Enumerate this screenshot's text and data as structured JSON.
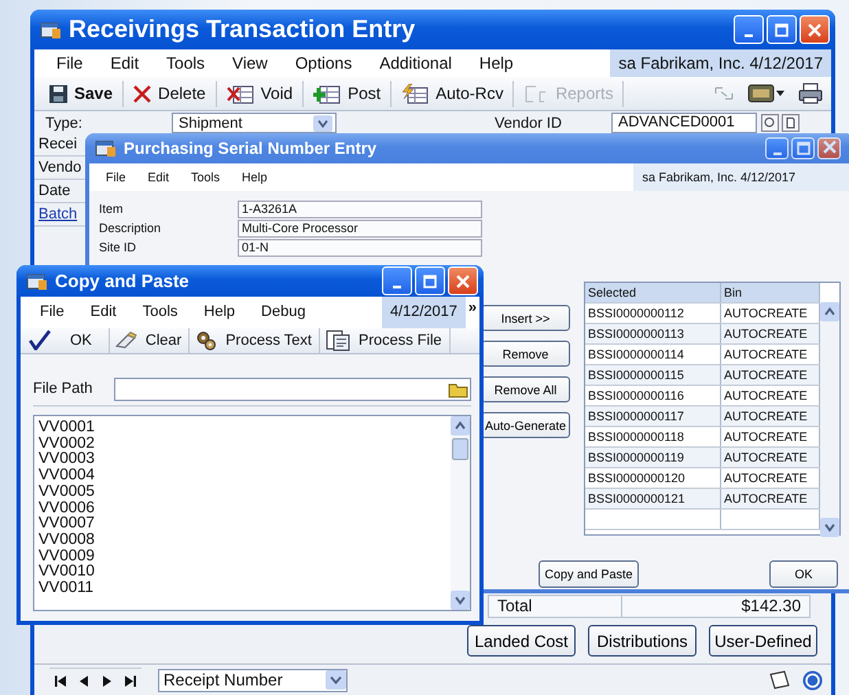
{
  "receivings_window": {
    "title": "Receivings Transaction Entry",
    "menu": [
      "File",
      "Edit",
      "Tools",
      "View",
      "Options",
      "Additional",
      "Help"
    ],
    "session": "sa  Fabrikam, Inc.  4/12/2017",
    "toolbar": [
      {
        "label": "Save",
        "kind": "save",
        "disabled": false
      },
      {
        "label": "Delete",
        "kind": "delete",
        "disabled": false
      },
      {
        "label": "Void",
        "kind": "void",
        "disabled": false
      },
      {
        "label": "Post",
        "kind": "post",
        "disabled": false
      },
      {
        "label": "Auto-Rcv",
        "kind": "autorcv",
        "disabled": false
      },
      {
        "label": "Reports",
        "kind": "reports",
        "disabled": true
      }
    ],
    "type_label": "Type:",
    "type_value": "Shipment",
    "vendor_id_label": "Vendor ID",
    "vendor_id_value": "ADVANCED0001",
    "side_labels": [
      {
        "text": "Recei",
        "kind": "label"
      },
      {
        "text": "Vendo",
        "kind": "label"
      },
      {
        "text": "Date",
        "kind": "label"
      },
      {
        "text": "Batch",
        "kind": "link"
      }
    ],
    "total_label": "Total",
    "total_value": "$142.30",
    "buttons": [
      "Landed Cost",
      "Distributions",
      "User-Defined"
    ],
    "browse_by": "Receipt Number"
  },
  "serial_window": {
    "title": "Purchasing Serial Number Entry",
    "menu": [
      "File",
      "Edit",
      "Tools",
      "Help"
    ],
    "session": "sa  Fabrikam, Inc.  4/12/2017",
    "fields": [
      {
        "label": "Item",
        "value": "1-A3261A"
      },
      {
        "label": "Description",
        "value": "Multi-Core Processor"
      },
      {
        "label": "Site ID",
        "value": "01-N"
      }
    ],
    "buttons": [
      "Insert >>",
      "Remove",
      "Remove All",
      "Auto-Generate"
    ],
    "grid": {
      "columns": [
        "Selected",
        "Bin"
      ],
      "rows": [
        [
          "BSSI0000000112",
          "AUTOCREATE"
        ],
        [
          "BSSI0000000113",
          "AUTOCREATE"
        ],
        [
          "BSSI0000000114",
          "AUTOCREATE"
        ],
        [
          "BSSI0000000115",
          "AUTOCREATE"
        ],
        [
          "BSSI0000000116",
          "AUTOCREATE"
        ],
        [
          "BSSI0000000117",
          "AUTOCREATE"
        ],
        [
          "BSSI0000000118",
          "AUTOCREATE"
        ],
        [
          "BSSI0000000119",
          "AUTOCREATE"
        ],
        [
          "BSSI0000000120",
          "AUTOCREATE"
        ],
        [
          "BSSI0000000121",
          "AUTOCREATE"
        ]
      ]
    },
    "bottom_buttons": [
      "Copy and Paste",
      "OK"
    ]
  },
  "copy_window": {
    "title": "Copy and Paste",
    "menu": [
      "File",
      "Edit",
      "Tools",
      "Help",
      "Debug"
    ],
    "date": "4/12/2017",
    "chevron": "»",
    "toolbar": [
      {
        "label": "OK",
        "kind": "ok"
      },
      {
        "label": "Clear",
        "kind": "clear"
      },
      {
        "label": "Process Text",
        "kind": "process_text"
      },
      {
        "label": "Process File",
        "kind": "process_file"
      }
    ],
    "file_path_label": "File Path",
    "lines": [
      "VV0001",
      "VV0002",
      "VV0003",
      "VV0004",
      "VV0005",
      "VV0006",
      "VV0007",
      "VV0008",
      "VV0009",
      "VV0010",
      "VV0011"
    ]
  }
}
